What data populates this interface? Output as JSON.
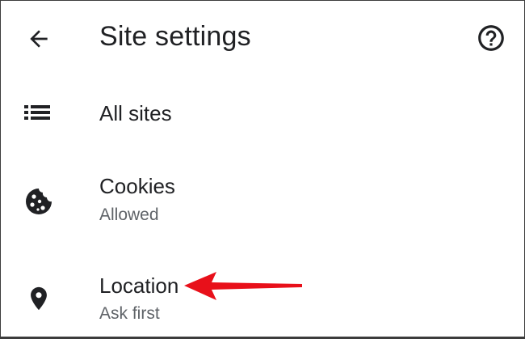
{
  "appbar": {
    "back_icon": "arrow-back-icon",
    "title": "Site settings",
    "help_icon": "help-circle-icon"
  },
  "rows": [
    {
      "label": "All sites",
      "icon": "list-icon"
    },
    {
      "label": "Cookies",
      "sub": "Allowed",
      "icon": "cookie-icon"
    },
    {
      "label": "Location",
      "sub": "Ask first",
      "icon": "location-pin-icon"
    }
  ],
  "annotation": {
    "color": "#e8101a",
    "icon": "red-arrow-pointer"
  }
}
